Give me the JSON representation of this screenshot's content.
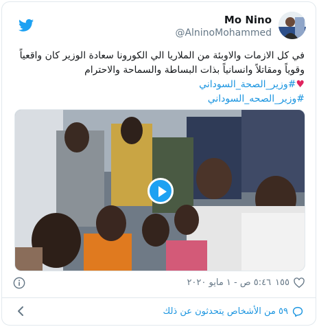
{
  "author": {
    "display_name": "Mo Nino",
    "handle": "@AlninoMohammed"
  },
  "tweet": {
    "text_main": "في كل الازمات والاوبئة من الملاريا الي الكورونا سعادة الوزير كان واقعياً وقوياً ومقاتلاً وانسانياً بذات البساطة والسماحة والاحترام ",
    "heart_emoji": "♥",
    "hashtag_1": "#وزير_الصحة_السوداني",
    "hashtag_2": "#وزير_الصحه_السوداني"
  },
  "meta": {
    "like_count": "١٥٥",
    "timestamp": "٥:٤٦ ص - ١ مايو ٢٠٢٠"
  },
  "footer": {
    "people_talking": "٥٩ من الأشخاص يتحدثون عن ذلك"
  },
  "colors": {
    "accent": "#1da1f2",
    "link": "#1b95e0",
    "heart": "#e0245e"
  },
  "icons": [
    "twitter-logo-icon",
    "play-icon",
    "info-icon",
    "heart-outline-icon",
    "speech-bubble-icon",
    "chevron-left-icon"
  ]
}
